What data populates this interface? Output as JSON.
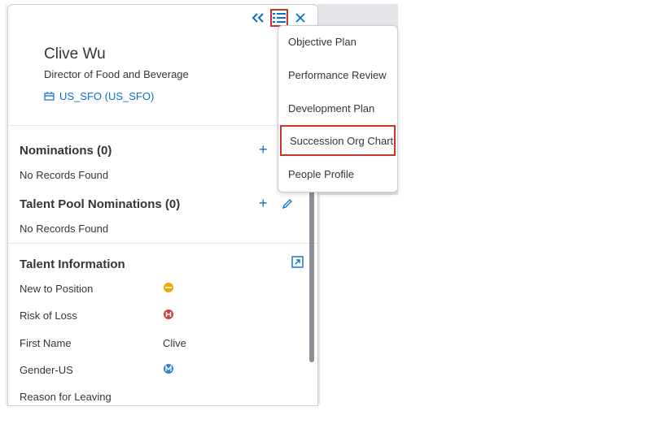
{
  "profile": {
    "name": "Clive Wu",
    "title": "Director of Food and Beverage",
    "location": "US_SFO (US_SFO)"
  },
  "toolbar": {
    "collapse_icon": "double-chevron-left-icon",
    "menu_icon": "list-icon",
    "close_icon": "close-icon"
  },
  "nominations": {
    "title": "Nominations (0)",
    "empty": "No Records Found"
  },
  "talent_pool": {
    "title": "Talent Pool Nominations (0)",
    "empty": "No Records Found"
  },
  "talent_info": {
    "title": "Talent Information",
    "rows": [
      {
        "label": "New to Position",
        "value": ""
      },
      {
        "label": "Risk of Loss",
        "value": ""
      },
      {
        "label": "First Name",
        "value": "Clive"
      },
      {
        "label": "Gender-US",
        "value": ""
      },
      {
        "label": "Reason for Leaving",
        "value": ""
      }
    ]
  },
  "menu": {
    "items": [
      "Objective Plan",
      "Performance Review",
      "Development Plan",
      "Succession Org Chart",
      "People Profile"
    ]
  },
  "colors": {
    "accent": "#0a6ed1",
    "highlight": "#c0392b",
    "new_to_position": "#f0ab00",
    "risk_high": "#d04343",
    "gender": "#3a80c8"
  }
}
